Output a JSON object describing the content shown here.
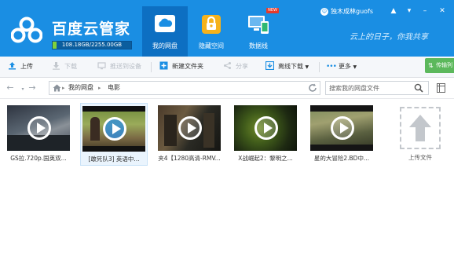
{
  "app": {
    "title": "百度云管家",
    "storage_text": "108.18GB/2255.00GB",
    "storage_used_fraction": 0.048,
    "slogan": "云上的日子，你我共享",
    "brand_color": "#1a8ee3"
  },
  "nav_tabs": [
    {
      "label": "我的网盘",
      "icon": "cloud-folder-icon",
      "active": true
    },
    {
      "label": "隐藏空间",
      "icon": "lock-icon",
      "active": false
    },
    {
      "label": "数据线",
      "icon": "devices-icon",
      "active": false,
      "badge": "NEW"
    }
  ],
  "user": {
    "name": "独木成林guofs",
    "window_buttons": [
      "skin-icon",
      "menu-icon",
      "minimize-icon",
      "close-icon"
    ]
  },
  "toolbar": {
    "upload": "上传",
    "download": "下载",
    "push_to_device": "推送到设备",
    "new_folder": "新建文件夹",
    "share": "分享",
    "offline_download": "离线下载",
    "more": "更多",
    "transfer_list": "传输列"
  },
  "address": {
    "crumbs": [
      "我的网盘",
      "电影"
    ],
    "search_placeholder": "搜索我的网盘文件"
  },
  "files": [
    {
      "name": "GS拉.720p.国英双...",
      "type": "video",
      "selected": false
    },
    {
      "name": "[敢死队3] 英语中...",
      "type": "video",
      "selected": true
    },
    {
      "name": "夹4【1280高清-RMV...",
      "type": "video",
      "selected": false
    },
    {
      "name": "X战崛起2：黎明之...",
      "type": "video",
      "selected": false
    },
    {
      "name": "星的大冒险2.BD中...",
      "type": "video",
      "selected": false
    }
  ],
  "upload_tile": {
    "label": "上传文件"
  }
}
